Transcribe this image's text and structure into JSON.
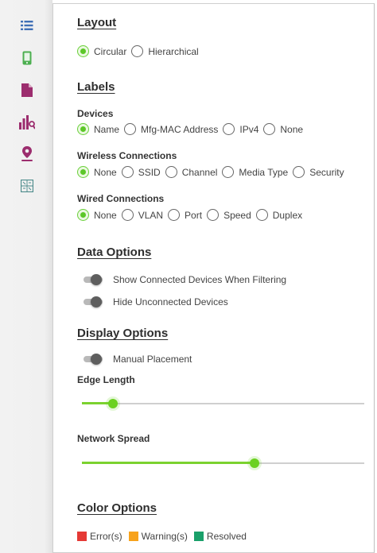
{
  "colors": {
    "accent": "#6ad03a",
    "error": "#e53935",
    "warning": "#f7a21b",
    "resolved": "#1aa06a",
    "rail_icon_blue": "#3f6fb6",
    "rail_icon_green": "#4caf50",
    "rail_icon_purple": "#9c2d6e"
  },
  "sidebar": {
    "icons": [
      {
        "name": "list-icon"
      },
      {
        "name": "mobile-device-icon"
      },
      {
        "name": "document-icon"
      },
      {
        "name": "chart-search-icon"
      },
      {
        "name": "location-pin-icon"
      },
      {
        "name": "map-grid-icon"
      }
    ]
  },
  "layout": {
    "heading": "Layout",
    "options": [
      {
        "label": "Circular",
        "selected": true
      },
      {
        "label": "Hierarchical",
        "selected": false
      }
    ]
  },
  "labels": {
    "heading": "Labels",
    "devices": {
      "title": "Devices",
      "options": [
        {
          "label": "Name",
          "selected": true
        },
        {
          "label": "Mfg-MAC Address",
          "selected": false
        },
        {
          "label": "IPv4",
          "selected": false
        },
        {
          "label": "None",
          "selected": false
        }
      ]
    },
    "wireless": {
      "title": "Wireless Connections",
      "options": [
        {
          "label": "None",
          "selected": true
        },
        {
          "label": "SSID",
          "selected": false
        },
        {
          "label": "Channel",
          "selected": false
        },
        {
          "label": "Media Type",
          "selected": false
        },
        {
          "label": "Security",
          "selected": false
        }
      ]
    },
    "wired": {
      "title": "Wired Connections",
      "options": [
        {
          "label": "None",
          "selected": true
        },
        {
          "label": "VLAN",
          "selected": false
        },
        {
          "label": "Port",
          "selected": false
        },
        {
          "label": "Speed",
          "selected": false
        },
        {
          "label": "Duplex",
          "selected": false
        }
      ]
    }
  },
  "data_options": {
    "heading": "Data Options",
    "toggles": [
      {
        "label": "Show Connected Devices When Filtering",
        "on": false
      },
      {
        "label": "Hide Unconnected Devices",
        "on": false
      }
    ]
  },
  "display_options": {
    "heading": "Display Options",
    "manual_placement": {
      "label": "Manual Placement",
      "on": false
    },
    "edge_length": {
      "label": "Edge Length",
      "value_fraction": 0.11
    },
    "network_spread": {
      "label": "Network Spread",
      "value_fraction": 0.61
    }
  },
  "color_options": {
    "heading": "Color Options",
    "legend": [
      {
        "label": "Error(s)",
        "color": "#e53935"
      },
      {
        "label": "Warning(s)",
        "color": "#f7a21b"
      },
      {
        "label": "Resolved",
        "color": "#1aa06a"
      }
    ]
  }
}
